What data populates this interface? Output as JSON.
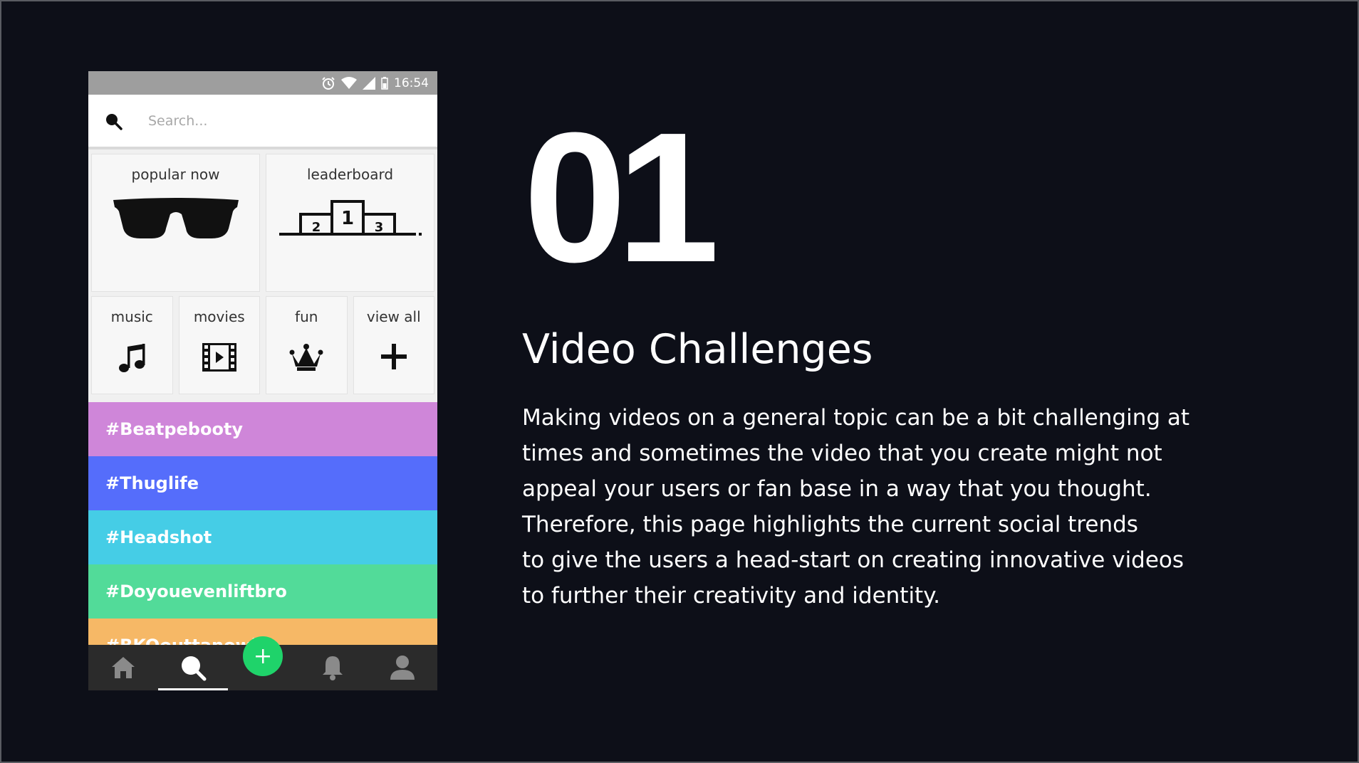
{
  "phone": {
    "statusbar": {
      "time": "16:54"
    },
    "search": {
      "placeholder": "Search..."
    },
    "featured_cards": [
      {
        "label": "popular now",
        "icon": "sunglasses-icon"
      },
      {
        "label": "leaderboard",
        "icon": "podium-icon",
        "podium": [
          "2",
          "1",
          "3"
        ]
      }
    ],
    "category_cards": [
      {
        "label": "music",
        "icon": "music-note-icon"
      },
      {
        "label": "movies",
        "icon": "film-icon"
      },
      {
        "label": "fun",
        "icon": "crown-icon"
      },
      {
        "label": "view all",
        "icon": "plus-icon"
      }
    ],
    "hashtags": [
      {
        "label": "#Beatpebooty",
        "color": "#cf86d9"
      },
      {
        "label": "#Thuglife",
        "color": "#556dfb"
      },
      {
        "label": "#Headshot",
        "color": "#45cde6"
      },
      {
        "label": "#Doyouevenliftbro",
        "color": "#52db99"
      },
      {
        "label": "#BKOouttanowh",
        "color": "#f6b866"
      }
    ],
    "bottom_nav": [
      "home-icon",
      "search-icon",
      "add-icon",
      "bell-icon",
      "profile-icon"
    ],
    "active_nav": "search-icon",
    "accent_color": "#1fd36a"
  },
  "slide": {
    "number": "01",
    "title": "Video Challenges",
    "description_lines": [
      "Making videos on a general topic can be a bit challenging at",
      "times and sometimes the video that you create might not",
      "appeal your users or fan base in a way that you thought.",
      "Therefore, this page highlights the current social trends",
      "to give the users a head-start on creating innovative videos",
      "to further their creativity and identity."
    ]
  }
}
